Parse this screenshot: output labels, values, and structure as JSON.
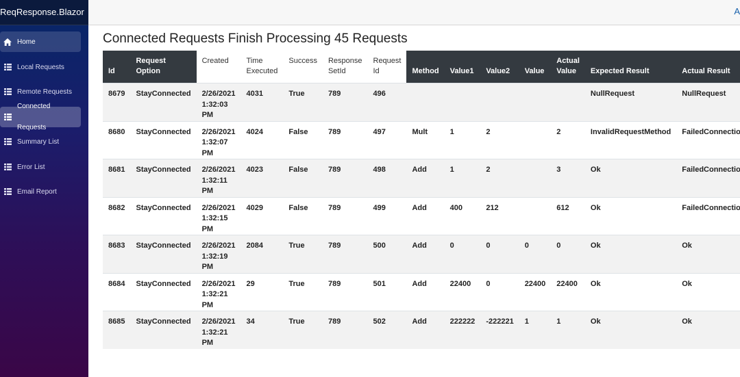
{
  "app": {
    "brand": "ReqResponse.Blazor",
    "about_link": "A"
  },
  "sidebar": {
    "items": [
      {
        "label": "Home",
        "icon": "home-icon"
      },
      {
        "label": "Local Requests",
        "icon": "list-icon"
      },
      {
        "label": "Remote Requests",
        "icon": "list-icon"
      },
      {
        "label": "Connected Requests",
        "icon": "list-icon",
        "active": true
      },
      {
        "label": "Summary List",
        "icon": "list-icon"
      },
      {
        "label": "Error List",
        "icon": "list-icon"
      },
      {
        "label": "Email Report",
        "icon": "list-icon"
      }
    ],
    "connected_line1": "Connected",
    "connected_line2": "Requests"
  },
  "main": {
    "title": "Connected Requests Finish Processing 45 Requests",
    "columns": [
      {
        "label": "Id",
        "style": "dark"
      },
      {
        "label": "Request Option",
        "style": "dark"
      },
      {
        "label": "Created",
        "style": "light"
      },
      {
        "label": "Time Executed",
        "style": "light"
      },
      {
        "label": "Success",
        "style": "light"
      },
      {
        "label": "Response SetId",
        "style": "light"
      },
      {
        "label": "Request Id",
        "style": "light"
      },
      {
        "label": "Method",
        "style": "dark"
      },
      {
        "label": "Value1",
        "style": "dark"
      },
      {
        "label": "Value2",
        "style": "dark"
      },
      {
        "label": "Value",
        "style": "dark"
      },
      {
        "label": "Actual Value",
        "style": "dark"
      },
      {
        "label": "Expected Result",
        "style": "dark"
      },
      {
        "label": "Actual Result",
        "style": "dark"
      }
    ],
    "rows": [
      [
        "8679",
        "StayConnected",
        "2/26/2021 1:32:03 PM",
        "4031",
        "True",
        "789",
        "496",
        "",
        "",
        "",
        "",
        "",
        "NullRequest",
        "NullRequest"
      ],
      [
        "8680",
        "StayConnected",
        "2/26/2021 1:32:07 PM",
        "4024",
        "False",
        "789",
        "497",
        "Mult",
        "1",
        "2",
        "",
        "2",
        "InvalidRequestMethod",
        "FailedConnection"
      ],
      [
        "8681",
        "StayConnected",
        "2/26/2021 1:32:11 PM",
        "4023",
        "False",
        "789",
        "498",
        "Add",
        "1",
        "2",
        "",
        "3",
        "Ok",
        "FailedConnection"
      ],
      [
        "8682",
        "StayConnected",
        "2/26/2021 1:32:15 PM",
        "4029",
        "False",
        "789",
        "499",
        "Add",
        "400",
        "212",
        "",
        "612",
        "Ok",
        "FailedConnection"
      ],
      [
        "8683",
        "StayConnected",
        "2/26/2021 1:32:19 PM",
        "2084",
        "True",
        "789",
        "500",
        "Add",
        "0",
        "0",
        "0",
        "0",
        "Ok",
        "Ok"
      ],
      [
        "8684",
        "StayConnected",
        "2/26/2021 1:32:21 PM",
        "29",
        "True",
        "789",
        "501",
        "Add",
        "22400",
        "0",
        "22400",
        "22400",
        "Ok",
        "Ok"
      ],
      [
        "8685",
        "StayConnected",
        "2/26/2021 1:32:21 PM",
        "34",
        "True",
        "789",
        "502",
        "Add",
        "222222",
        "-222221",
        "1",
        "1",
        "Ok",
        "Ok"
      ]
    ]
  }
}
